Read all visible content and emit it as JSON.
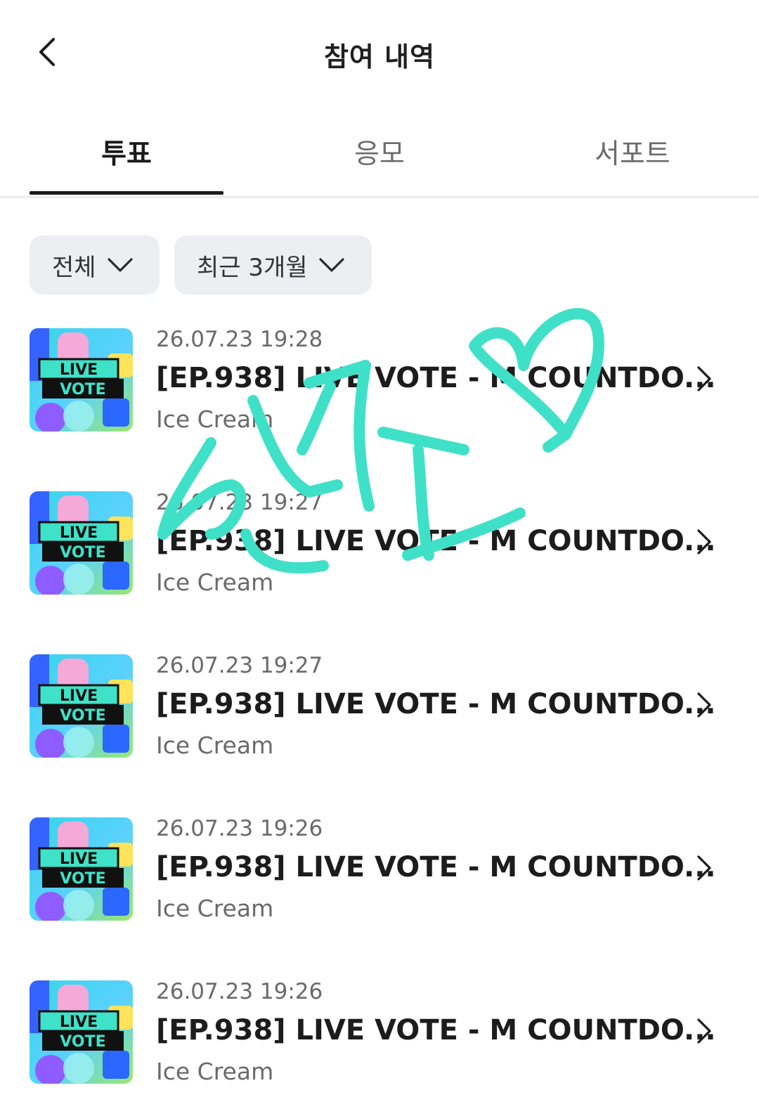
{
  "header": {
    "title": "참여 내역",
    "back_icon": "chevron-left-icon"
  },
  "tabs": [
    {
      "label": "투표",
      "active": true
    },
    {
      "label": "응모",
      "active": false
    },
    {
      "label": "서포트",
      "active": false
    }
  ],
  "filters": [
    {
      "label": "전체",
      "icon": "chevron-down-icon"
    },
    {
      "label": "최근 3개월",
      "icon": "chevron-down-icon"
    }
  ],
  "items": [
    {
      "date": "26.07.23 19:28",
      "title": "[EP.938] LIVE VOTE - M COUNTDO...",
      "subtitle": "Ice Cream"
    },
    {
      "date": "26.07.23 19:27",
      "title": "[EP.938] LIVE VOTE - M COUNTDO...",
      "subtitle": "Ice Cream"
    },
    {
      "date": "26.07.23 19:27",
      "title": "[EP.938] LIVE VOTE - M COUNTDO...",
      "subtitle": "Ice Cream"
    },
    {
      "date": "26.07.23 19:26",
      "title": "[EP.938] LIVE VOTE - M COUNTDO...",
      "subtitle": "Ice Cream"
    },
    {
      "date": "26.07.23 19:26",
      "title": "[EP.938] LIVE VOTE - M COUNTDO...",
      "subtitle": "Ice Cream"
    }
  ],
  "thumbnail": {
    "line1": "LIVE",
    "line2": "VOTE"
  },
  "colors": {
    "accent": "#1a1a1a",
    "chip_bg": "#eceef1",
    "doodle": "#3fe0c8",
    "muted_text": "#6a6a6a"
  }
}
